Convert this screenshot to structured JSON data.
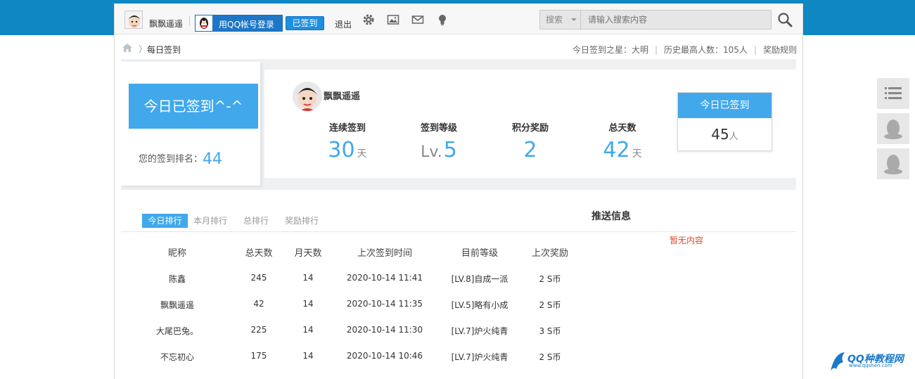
{
  "topbar": {
    "username": "飘飘遥遥",
    "qq_login_label": "用QQ帐号登录",
    "signed_label": "已签到",
    "logout_label": "退出",
    "search": {
      "scope": "搜索",
      "placeholder": "请输入搜索内容"
    }
  },
  "breadcrumb": {
    "current": "每日签到",
    "star_label": "今日签到之星：",
    "star_name": "大明",
    "history_label": "历史最高人数：",
    "history_value": "105人",
    "reward_rules": "奖励规则"
  },
  "sign": {
    "button_label": "今日已签到^-^",
    "rank_label": "您的签到排名：",
    "rank_value": "44"
  },
  "stats": {
    "username": "飘飘遥遥",
    "items": [
      {
        "label": "连续签到",
        "value": "30",
        "unit": "天"
      },
      {
        "label": "签到等级",
        "prefix": "Lv.",
        "value": "5",
        "unit": ""
      },
      {
        "label": "积分奖励",
        "value": "2",
        "unit": ""
      },
      {
        "label": "总天数",
        "value": "42",
        "unit": "天"
      }
    ],
    "today": {
      "title": "今日已签到",
      "count": "45",
      "unit": "人"
    }
  },
  "tabs": [
    "今日排行",
    "本月排行",
    "总排行",
    "奖励排行"
  ],
  "push": {
    "title": "推送信息",
    "empty": "暂无内容"
  },
  "table": {
    "headers": [
      "昵称",
      "总天数",
      "月天数",
      "上次签到时间",
      "目前等级",
      "上次奖励"
    ],
    "rows": [
      [
        "陈鑫",
        "245",
        "14",
        "2020-10-14 11:41",
        "[LV.8]自成一派",
        "2 S币"
      ],
      [
        "飘飘遥遥",
        "42",
        "14",
        "2020-10-14 11:35",
        "[LV.5]略有小成",
        "2 S币"
      ],
      [
        "大尾巴兔。",
        "225",
        "14",
        "2020-10-14 11:30",
        "[LV.7]炉火纯青",
        "3 S币"
      ],
      [
        "不忘初心",
        "175",
        "14",
        "2020-10-14 10:46",
        "[LV.7]炉火纯青",
        "2 S币"
      ]
    ]
  },
  "watermark": {
    "text": "QQ种教程网",
    "sub": "www.qqshen.com"
  },
  "colors": {
    "brand_band": "#0e87c3",
    "accent": "#41a8ec",
    "empty_text": "#e24a2a"
  }
}
